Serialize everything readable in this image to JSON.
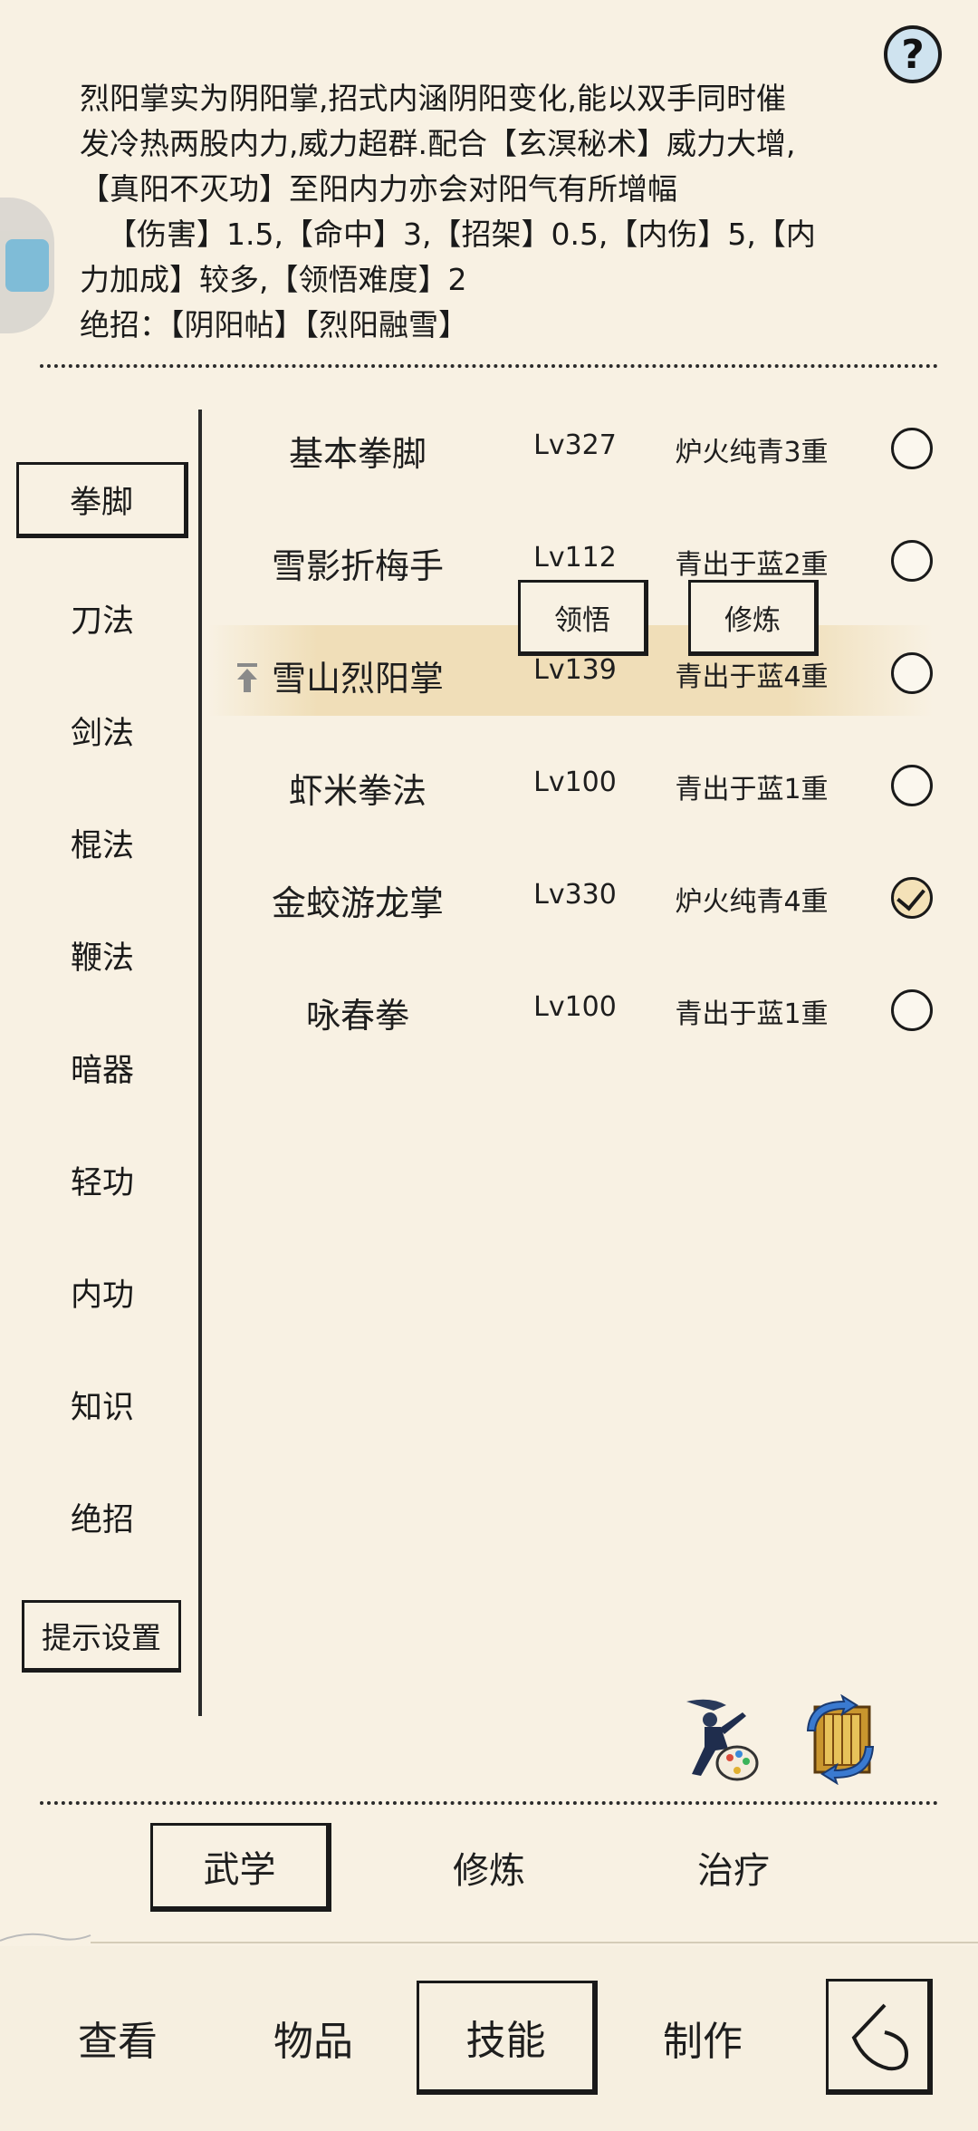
{
  "help": {
    "label": "?"
  },
  "description": {
    "lines": [
      "烈阳掌实为阴阳掌,招式内涵阴阳变化,能以双手同时催",
      "发冷热两股内力,威力超群.配合【玄溟秘术】威力大增,",
      "【真阳不灭功】至阳内力亦会对阳气有所增幅",
      "【伤害】1.5,【命中】3,【招架】0.5,【内伤】5,【内",
      "力加成】较多,【领悟难度】2",
      "绝招：【阴阳帖】【烈阳融雪】"
    ]
  },
  "categories": [
    {
      "label": "拳脚",
      "active": true
    },
    {
      "label": "刀法"
    },
    {
      "label": "剑法"
    },
    {
      "label": "棍法"
    },
    {
      "label": "鞭法"
    },
    {
      "label": "暗器"
    },
    {
      "label": "轻功"
    },
    {
      "label": "内功"
    },
    {
      "label": "知识"
    },
    {
      "label": "绝招"
    }
  ],
  "hint_settings": {
    "label": "提示设置"
  },
  "skills": [
    {
      "name": "基本拳脚",
      "level": "Lv327",
      "rank": "炉火纯青3重",
      "checked": false
    },
    {
      "name": "雪影折梅手",
      "level": "Lv112",
      "rank": "青出于蓝2重",
      "checked": false
    },
    {
      "name": "雪山烈阳掌",
      "level": "Lv139",
      "rank": "青出于蓝4重",
      "checked": false,
      "selected": true
    },
    {
      "name": "虾米拳法",
      "level": "Lv100",
      "rank": "青出于蓝1重",
      "checked": false
    },
    {
      "name": "金蛟游龙掌",
      "level": "Lv330",
      "rank": "炉火纯青4重",
      "checked": true
    },
    {
      "name": "咏春拳",
      "level": "Lv100",
      "rank": "青出于蓝1重",
      "checked": false
    }
  ],
  "popup": {
    "comprehend_label": "领悟",
    "train_label": "修炼"
  },
  "mode_tabs": [
    {
      "label": "武学",
      "active": true
    },
    {
      "label": "修炼"
    },
    {
      "label": "治疗"
    }
  ],
  "bottom_nav": [
    {
      "label": "查看"
    },
    {
      "label": "物品"
    },
    {
      "label": "技能",
      "active": true
    },
    {
      "label": "制作"
    }
  ],
  "colors": {
    "background": "#f8f1e3",
    "highlight": "#edd8aa",
    "help_bg": "#cfe3ef"
  },
  "icons": [
    "help-icon",
    "martial-artist-palette-icon",
    "book-swap-icon",
    "back-arrow-icon",
    "upgrade-arrow-icon"
  ]
}
